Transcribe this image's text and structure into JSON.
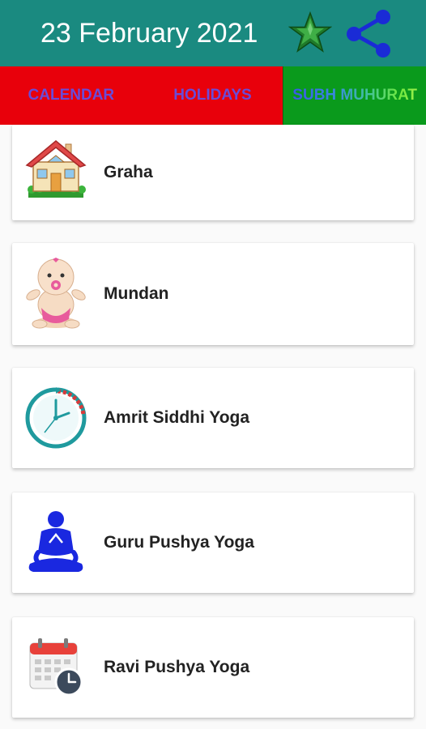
{
  "header": {
    "date_title": "23 February 2021",
    "star_icon": "star-icon",
    "share_icon": "share-icon",
    "colors": {
      "app_bar": "#1a8a80",
      "title": "#ffffff"
    }
  },
  "tabs": [
    {
      "label": "CALENDAR",
      "color": "#e8000b"
    },
    {
      "label": "HOLIDAYS",
      "color": "#e8000b"
    },
    {
      "label": "SUBH MUHURAT",
      "color": "#0a9a1c",
      "selected": true
    }
  ],
  "items": [
    {
      "label": "Graha",
      "icon": "house-icon"
    },
    {
      "label": "Mundan",
      "icon": "baby-icon"
    },
    {
      "label": "Amrit Siddhi Yoga",
      "icon": "clock-icon"
    },
    {
      "label": "Guru Pushya Yoga",
      "icon": "meditation-icon"
    },
    {
      "label": "Ravi Pushya Yoga",
      "icon": "calendar-clock-icon"
    }
  ]
}
